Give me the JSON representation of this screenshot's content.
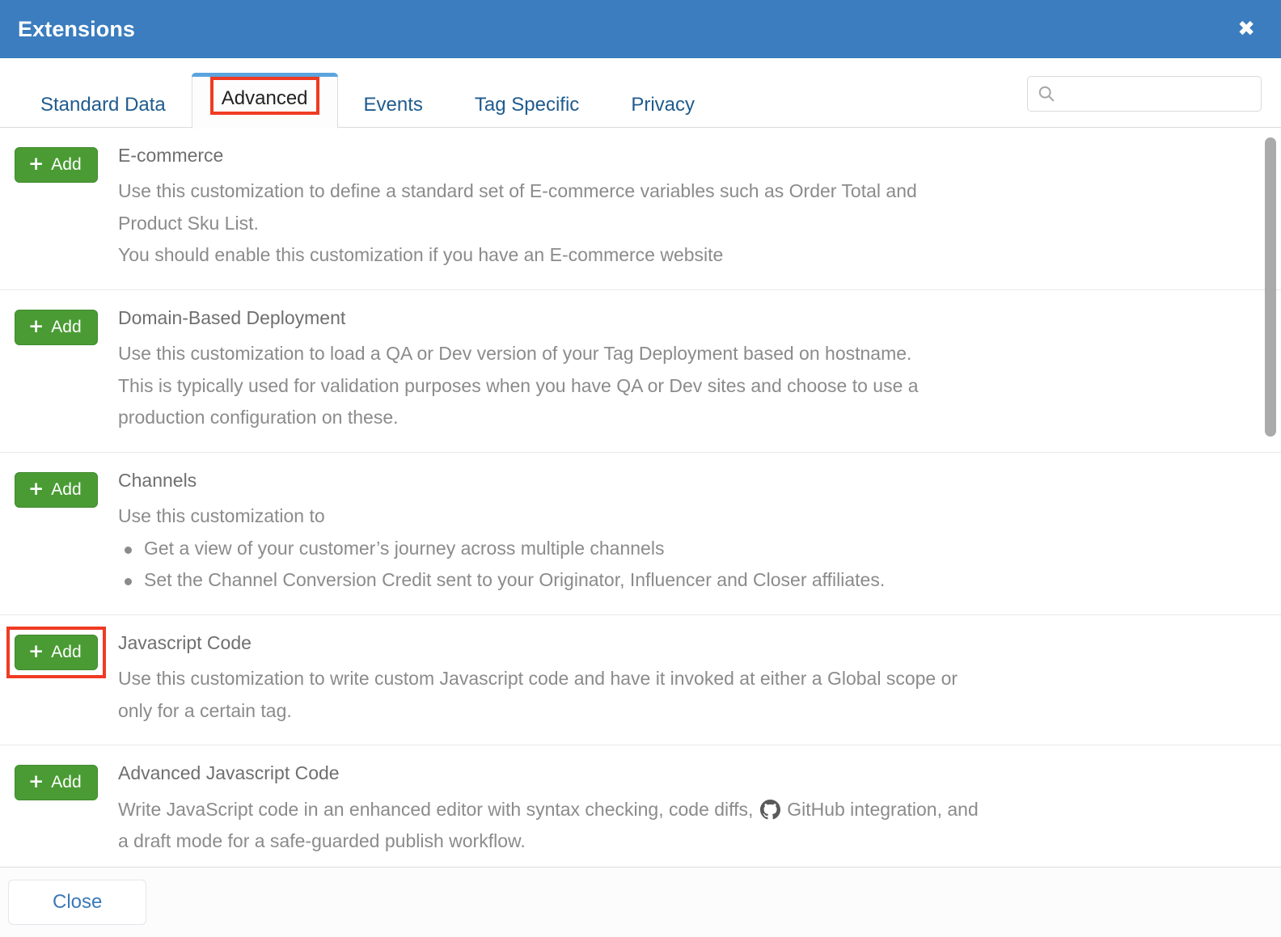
{
  "header": {
    "title": "Extensions",
    "close_icon": "close-x-icon",
    "close_label": "✖"
  },
  "tabs": [
    {
      "label": "Standard Data",
      "active": false
    },
    {
      "label": "Advanced",
      "active": true
    },
    {
      "label": "Events",
      "active": false
    },
    {
      "label": "Tag Specific",
      "active": false
    },
    {
      "label": "Privacy",
      "active": false
    }
  ],
  "search": {
    "icon": "search-icon",
    "value": "",
    "placeholder": ""
  },
  "extensions": [
    {
      "add_label": "Add",
      "plus": "+",
      "title": "E-commerce",
      "lines": [
        "Use this customization to define a standard set of E-commerce variables such as Order Total and",
        "Product Sku List.",
        "You should enable this customization if you have an E-commerce website"
      ],
      "bullets": [],
      "highlighted": false
    },
    {
      "add_label": "Add",
      "plus": "+",
      "title": "Domain-Based Deployment",
      "lines": [
        "Use this customization to load a QA or Dev version of your Tag Deployment based on hostname.",
        "This is typically used for validation purposes when you have QA or Dev sites and choose to use a",
        "production configuration on these."
      ],
      "bullets": [],
      "highlighted": false
    },
    {
      "add_label": "Add",
      "plus": "+",
      "title": "Channels",
      "lines": [
        "Use this customization to"
      ],
      "bullets": [
        "Get a view of your customer’s journey across multiple channels",
        "Set the Channel Conversion Credit sent to your Originator, Influencer and Closer affiliates."
      ],
      "highlighted": false
    },
    {
      "add_label": "Add",
      "plus": "+",
      "title": "Javascript Code",
      "lines": [
        "Use this customization to write custom Javascript code and have it invoked at either a Global scope or",
        "only for a certain tag."
      ],
      "bullets": [],
      "highlighted": true
    },
    {
      "add_label": "Add",
      "plus": "+",
      "title": "Advanced Javascript Code",
      "lines_with_icon": {
        "before": "Write JavaScript code in an enhanced editor with syntax checking, code diffs,",
        "icon": "github-icon",
        "after": "GitHub integration, and"
      },
      "lines": [
        "a draft mode for a safe-guarded publish workflow."
      ],
      "bullets": [],
      "highlighted": false
    }
  ],
  "footer": {
    "close_label": "Close"
  },
  "colors": {
    "header_blue": "#3b7dbe",
    "tab_blue": "#1f5b8e",
    "active_tab_bar": "#5ba4de",
    "add_green": "#4a9b34",
    "highlight_red": "#ef3b23",
    "link_blue": "#3b79b8",
    "text_gray": "#8b8b8b",
    "title_gray": "#6f6f6f"
  }
}
